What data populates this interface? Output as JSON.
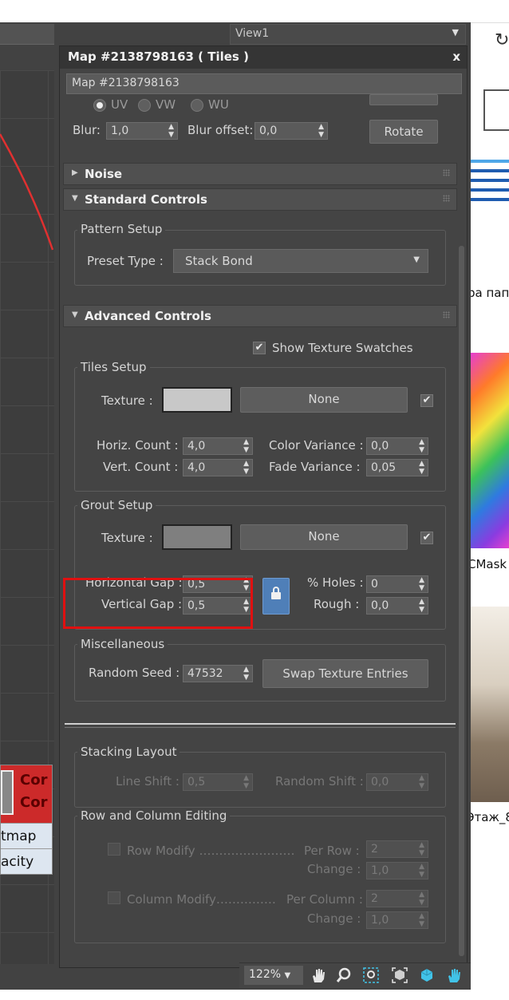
{
  "viewport": {
    "view_dropdown": "View1",
    "node": {
      "title_line1": "Cor",
      "title_line2": "Cor",
      "slot1": "tmap",
      "slot2": "acity"
    }
  },
  "right_strip": {
    "text1": "ра пап",
    "text2": "CMask",
    "text3": "Этаж_8"
  },
  "dialog": {
    "title": "Map #2138798163  ( Tiles )",
    "close": "x",
    "name_field": "Map #2138798163",
    "coords": {
      "radio_uv": "UV",
      "radio_vw": "VW",
      "radio_wu": "WU",
      "blur_label": "Blur:",
      "blur_value": "1,0",
      "blur_offset_label": "Blur offset:",
      "blur_offset_value": "0,0",
      "rotate_button": "Rotate"
    },
    "noise_rollout": "Noise",
    "standard_rollout": "Standard Controls",
    "pattern_setup": {
      "title": "Pattern Setup",
      "preset_label": "Preset Type :",
      "preset_value": "Stack Bond"
    },
    "advanced_rollout": "Advanced Controls",
    "show_swatches": "Show Texture Swatches",
    "tiles_setup": {
      "title": "Tiles Setup",
      "texture_label": "Texture :",
      "texture_button": "None",
      "swatch_color": "#c8c8c8",
      "horiz_label": "Horiz. Count :",
      "horiz_value": "4,0",
      "vert_label": "Vert. Count :",
      "vert_value": "4,0",
      "color_var_label": "Color Variance :",
      "color_var_value": "0,0",
      "fade_var_label": "Fade Variance :",
      "fade_var_value": "0,05"
    },
    "grout_setup": {
      "title": "Grout Setup",
      "texture_label": "Texture :",
      "texture_button": "None",
      "swatch_color": "#7f7f7f",
      "hgap_label": "Horizontal Gap :",
      "hgap_value": "0,5",
      "vgap_label": "Vertical Gap :",
      "vgap_value": "0,5",
      "holes_label": "% Holes :",
      "holes_value": "0",
      "rough_label": "Rough :",
      "rough_value": "0,0"
    },
    "misc": {
      "title": "Miscellaneous",
      "seed_label": "Random Seed :",
      "seed_value": "47532",
      "swap_button": "Swap Texture Entries"
    },
    "stacking": {
      "title": "Stacking Layout",
      "line_shift_label": "Line Shift :",
      "line_shift_value": "0,5",
      "random_shift_label": "Random Shift :",
      "random_shift_value": "0,0"
    },
    "row_col": {
      "title": "Row and Column Editing",
      "row_modify": "Row Modify",
      "per_row_label": "Per Row :",
      "per_row_value": "2",
      "change1_label": "Change :",
      "change1_value": "1,0",
      "col_modify": "Column Modify",
      "per_col_label": "Per Column :",
      "per_col_value": "2",
      "change2_label": "Change :",
      "change2_value": "1,0"
    }
  },
  "status_bar": {
    "zoom": "122%"
  }
}
